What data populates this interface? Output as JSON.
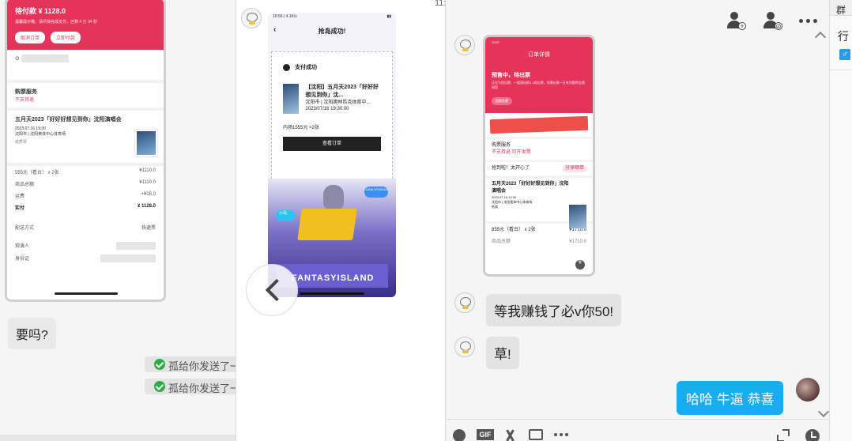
{
  "left_screenshot": {
    "header_title": "待付款 ¥ 1128.0",
    "header_sub": "温馨提示哦，请尽快完成支付，还剩 4 分 34 秒",
    "btn_cancel": "取消订单",
    "btn_pay": "立即付款",
    "addr_line": "沈阳市沈河区...",
    "service_title": "购票服务",
    "service_value": "不支持退",
    "event_title": "五月天2023「好好好想见到你」沈阳演唱会",
    "event_time": "2023.07.16 19:30",
    "event_venue": "沈阳市 | 沈阳奥体中心体育场",
    "event_map": "查看场馆地图",
    "event_tag": "纸质票",
    "notice": "须知事项 >",
    "ticket_line": "555元（看台） x 2张",
    "ticket_price": "¥1110.0",
    "goods_total_label": "商品总额",
    "goods_total": "¥1110.0",
    "shipping_label": "运费",
    "shipping": "+¥18.0",
    "pay_label": "实付",
    "pay_value": "¥ 1128.0",
    "delivery_label": "配送方式",
    "delivery_value": "快递票",
    "viewer_label": "观演人",
    "id_label": "身份证"
  },
  "left_chat": {
    "bubble_text": "要吗?",
    "sys_note_1": "孤给你发送了一",
    "sys_note_2": "孤给你发送了一"
  },
  "middle_screenshot": {
    "status_time": "10:56 | 4.1K/s",
    "nav_title": "抢岛成功!",
    "pay_status": "支付成功",
    "item_title": "【沈阳】五月天2023「好好好想见到你」沈...",
    "item_venue": "沈阳市 | 沈阳奥林匹克体育中...",
    "item_time": "2023/07/16 19:30:00",
    "price_line": "内场1555元 ×2张",
    "view_order": "查看订单",
    "banner_text": "FANTASYISLAND",
    "banner_tags": [
      "小岛",
      "来吃岛",
      "ASIA STADIUM"
    ],
    "clip_time": "11:"
  },
  "right_screenshot": {
    "status_time": "10:57",
    "nav_title": "订单详情",
    "pre_title": "预售中，待出票",
    "pre_sub": "正在为您出票，一般演出前2-4周出票，如需出票一旦有问题将会通知您",
    "pre_btn": "回顾发票",
    "service_title": "购票服务",
    "service_tags": "不支持退   可开发票",
    "promo": "抢到啦！太开心了",
    "promo_btn": "分享晒单",
    "event_title": "五月天2023「好好好想见到你」沈阳演唱会",
    "event_time": "2023.07.16 19:30",
    "event_venue": "沈阳市 | 沈阳奥体中心体育场",
    "notice": "须知事项 >",
    "tag": "纸质",
    "ticket_line": "855元（看台） x 2张",
    "ticket_price": "¥1710.0",
    "goods_label": "商品总额",
    "goods_price": "¥1710.0"
  },
  "right_chat": {
    "messages": [
      {
        "text": "等我赚钱了必v你50!"
      },
      {
        "text": "草!"
      },
      {
        "text": "哈哈 牛逼 恭喜"
      }
    ],
    "toolbar_icons": [
      "emoji-icon",
      "gif-icon",
      "scissors-icon",
      "image-icon",
      "more-icon",
      "expand-icon",
      "history-icon"
    ]
  },
  "topbar_icons": [
    "add-member-icon",
    "remove-member-icon",
    "more-icon"
  ],
  "sidebar": {
    "header": "群",
    "text": "行",
    "gender": "♂"
  }
}
